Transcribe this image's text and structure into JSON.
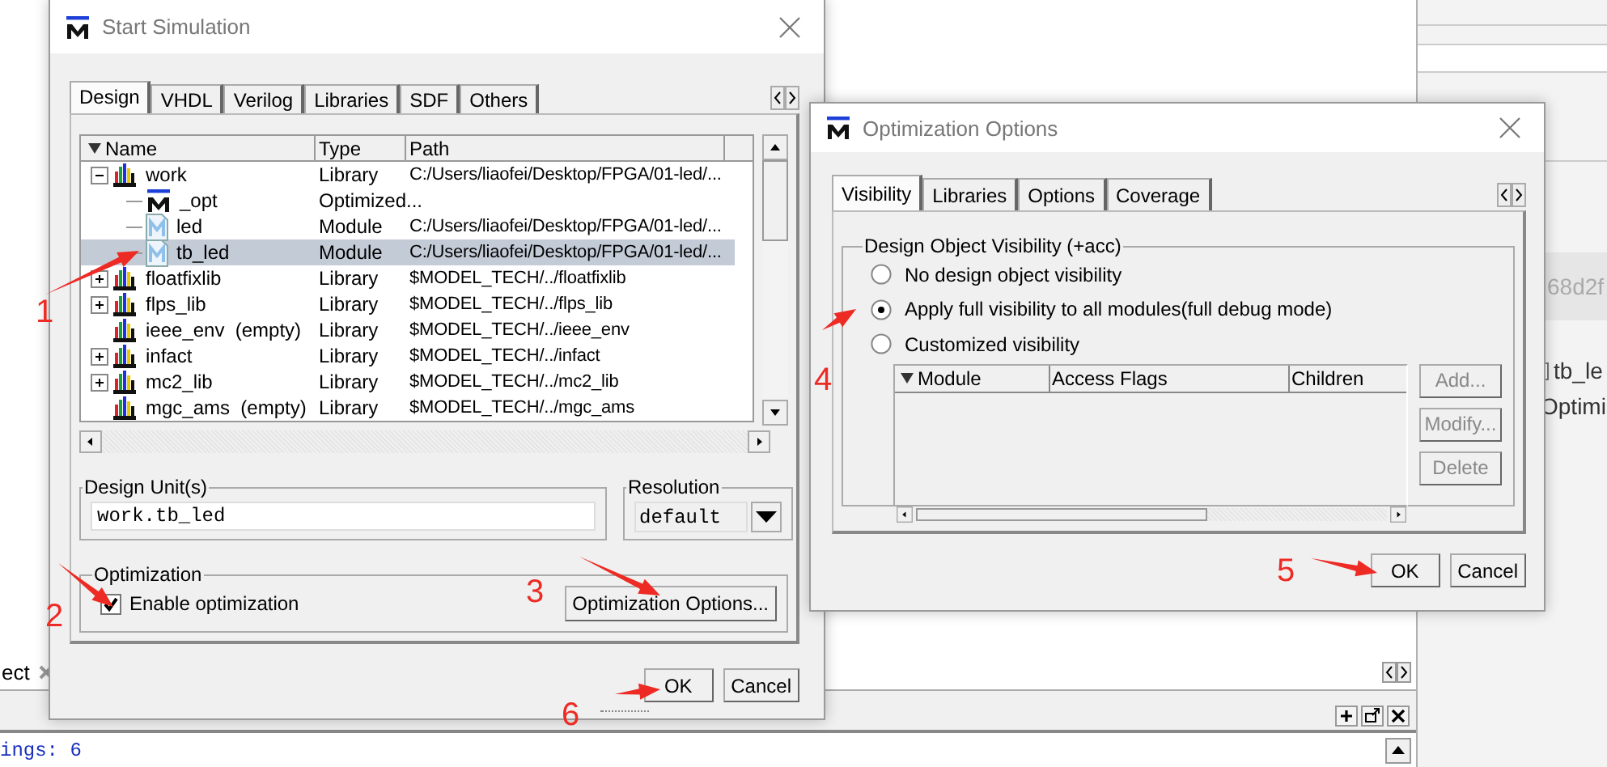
{
  "background": {
    "project_tab": "ect",
    "transcript_line": "ings: 6",
    "side_texts": [
      "68d2f",
      "tb_le",
      "Optimi"
    ]
  },
  "start_simulation": {
    "title": "Start Simulation",
    "tabs": [
      {
        "label": "Design",
        "selected": true
      },
      {
        "label": "VHDL",
        "selected": false
      },
      {
        "label": "Verilog",
        "selected": false
      },
      {
        "label": "Libraries",
        "selected": false
      },
      {
        "label": "SDF",
        "selected": false
      },
      {
        "label": "Others",
        "selected": false
      }
    ],
    "columns": [
      "Name",
      "Type",
      "Path"
    ],
    "tree": [
      {
        "kind": "library",
        "name": "work",
        "type": "Library",
        "path": "C:/Users/liaofei/Desktop/FPGA/01-led/...",
        "expanded": true,
        "selected": false,
        "children": [
          {
            "kind": "optimized",
            "name": "_opt",
            "type": "Optimized...",
            "selected": false
          },
          {
            "kind": "module",
            "name": "led",
            "type": "Module",
            "path": "C:/Users/liaofei/Desktop/FPGA/01-led/...",
            "selected": false
          },
          {
            "kind": "module",
            "name": "tb_led",
            "type": "Module",
            "path": "C:/Users/liaofei/Desktop/FPGA/01-led/...",
            "selected": true
          }
        ]
      },
      {
        "kind": "library",
        "name": "floatfixlib",
        "type": "Library",
        "path": "$MODEL_TECH/../floatfixlib",
        "expanded": false,
        "selected": false
      },
      {
        "kind": "library",
        "name": "flps_lib",
        "type": "Library",
        "path": "$MODEL_TECH/../flps_lib",
        "expanded": false,
        "selected": false
      },
      {
        "kind": "library",
        "name": "ieee_env  (empty)",
        "type": "Library",
        "path": "$MODEL_TECH/../ieee_env",
        "selected": false
      },
      {
        "kind": "library",
        "name": "infact",
        "type": "Library",
        "path": "$MODEL_TECH/../infact",
        "expanded": false,
        "selected": false
      },
      {
        "kind": "library",
        "name": "mc2_lib",
        "type": "Library",
        "path": "$MODEL_TECH/../mc2_lib",
        "expanded": false,
        "selected": false
      },
      {
        "kind": "library",
        "name": "mgc_ams  (empty)",
        "type": "Library",
        "path": "$MODEL_TECH/../mgc_ams",
        "selected": false
      }
    ],
    "design_unit": {
      "label": "Design Unit(s)",
      "value": "work.tb_led"
    },
    "resolution": {
      "label": "Resolution",
      "value": "default"
    },
    "optimization": {
      "label": "Optimization",
      "enable": {
        "label": "Enable optimization",
        "checked": true
      },
      "button": "Optimization Options..."
    },
    "buttons": [
      "OK",
      "Cancel"
    ]
  },
  "optimization_options": {
    "title": "Optimization Options",
    "tabs": [
      {
        "label": "Visibility",
        "selected": true
      },
      {
        "label": "Libraries",
        "selected": false
      },
      {
        "label": "Options",
        "selected": false
      },
      {
        "label": "Coverage",
        "selected": false
      }
    ],
    "group_label": "Design Object Visibility (+acc)",
    "radios": [
      {
        "label": "No design object visibility",
        "selected": false
      },
      {
        "label": "Apply full visibility to all modules(full debug mode)",
        "selected": true
      },
      {
        "label": "Customized visibility",
        "selected": false
      }
    ],
    "columns": [
      "Module",
      "Access Flags",
      "Children"
    ],
    "side_buttons": [
      {
        "label": "Add...",
        "disabled": true
      },
      {
        "label": "Modify...",
        "disabled": true
      },
      {
        "label": "Delete",
        "disabled": true
      }
    ],
    "buttons": [
      "OK",
      "Cancel"
    ]
  },
  "annotations": [
    {
      "label": "1"
    },
    {
      "label": "2"
    },
    {
      "label": "3"
    },
    {
      "label": "4"
    },
    {
      "label": "5"
    },
    {
      "label": "6"
    }
  ]
}
